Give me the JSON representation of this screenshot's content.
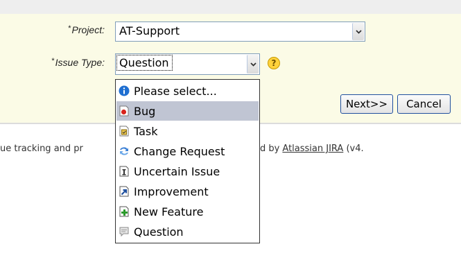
{
  "form": {
    "project": {
      "required_mark": "*",
      "label": "Project:",
      "value": "AT-Support"
    },
    "issue_type": {
      "required_mark": "*",
      "label": "Issue Type:",
      "value": "Question",
      "help_glyph": "?"
    },
    "next_label": "Next>>",
    "cancel_label": "Cancel"
  },
  "dropdown": {
    "options": [
      {
        "label": "Please select...",
        "icon": "info-icon"
      },
      {
        "label": "Bug",
        "icon": "bug-icon",
        "highlighted": true
      },
      {
        "label": "Task",
        "icon": "task-icon"
      },
      {
        "label": "Change Request",
        "icon": "change-request-icon"
      },
      {
        "label": "Uncertain Issue",
        "icon": "uncertain-issue-icon"
      },
      {
        "label": "Improvement",
        "icon": "improvement-icon"
      },
      {
        "label": "New Feature",
        "icon": "new-feature-icon"
      },
      {
        "label": "Question",
        "icon": "question-icon"
      }
    ]
  },
  "footer": {
    "text_before": "ue tracking and pr",
    "text_middle": "are powered by ",
    "link": "Atlassian JIRA",
    "text_after": " (v4."
  },
  "colors": {
    "panel_bg": "#fbfbe6",
    "highlight": "#c0c5d3",
    "button_border": "#1f4f9e"
  }
}
